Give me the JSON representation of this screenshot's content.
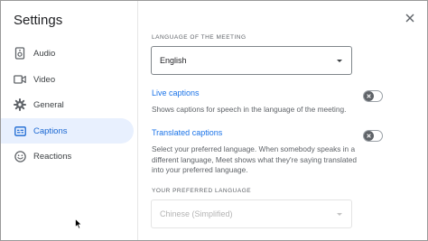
{
  "sidebar": {
    "title": "Settings",
    "items": [
      {
        "label": "Audio",
        "icon": "speaker-icon",
        "active": false
      },
      {
        "label": "Video",
        "icon": "videocam-icon",
        "active": false
      },
      {
        "label": "General",
        "icon": "gear-icon",
        "active": false
      },
      {
        "label": "Captions",
        "icon": "closed-caption-icon",
        "active": true
      },
      {
        "label": "Reactions",
        "icon": "smiley-icon",
        "active": false
      }
    ]
  },
  "main": {
    "meeting_language": {
      "label": "LANGUAGE OF THE MEETING",
      "value": "English"
    },
    "live_captions": {
      "title": "Live captions",
      "description": "Shows captions for speech in the language of the meeting.",
      "enabled": false
    },
    "translated_captions": {
      "title": "Translated captions",
      "description": "Select your preferred language. When somebody speaks in a different language, Meet shows what they're saying translated into your preferred language.",
      "enabled": false
    },
    "preferred_language": {
      "label": "YOUR PREFERRED LANGUAGE",
      "value": "Chinese (Simplified)",
      "disabled": true
    }
  },
  "colors": {
    "accent": "#1a73e8",
    "active_bg": "#e8f0fe",
    "toggle_knob": "#5f6368"
  }
}
